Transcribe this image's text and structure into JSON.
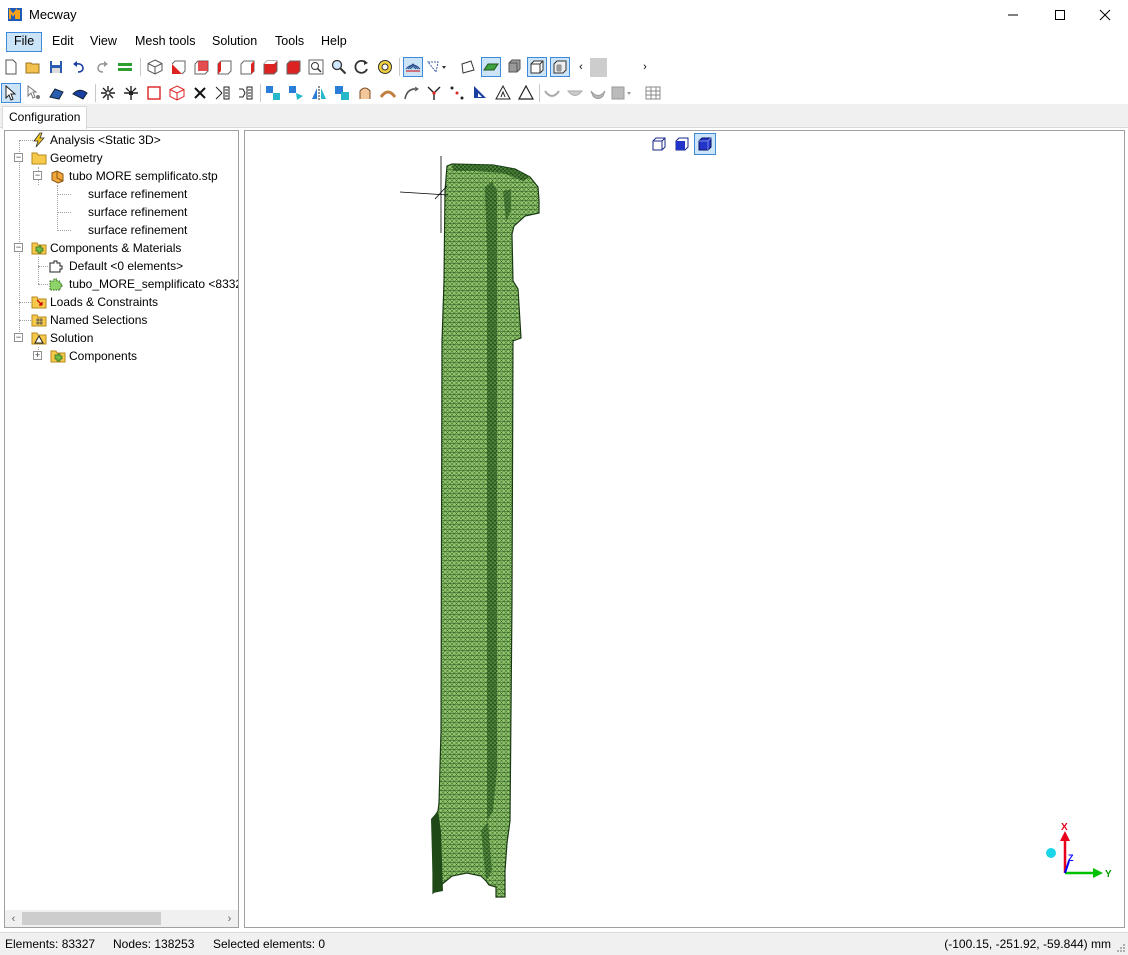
{
  "window": {
    "title": "Mecway"
  },
  "menu": {
    "items": [
      "File",
      "Edit",
      "View",
      "Mesh tools",
      "Solution",
      "Tools",
      "Help"
    ],
    "active": "File"
  },
  "tabs": {
    "configuration": "Configuration"
  },
  "tree": {
    "analysis": "Analysis <Static 3D>",
    "geometry": "Geometry",
    "geometry_file": "tubo MORE semplificato.stp",
    "refinement_1": "surface refinement",
    "refinement_2": "surface refinement",
    "refinement_3": "surface refinement",
    "components_materials": "Components & Materials",
    "default_component": "Default <0 elements>",
    "tube_component": "tubo_MORE_semplificato <8332",
    "loads_constraints": "Loads & Constraints",
    "named_selections": "Named Selections",
    "solution": "Solution",
    "solution_components": "Components"
  },
  "axes": {
    "x": "X",
    "y": "Y",
    "z": "Z"
  },
  "status": {
    "elements": "Elements: 83327",
    "nodes": "Nodes: 138253",
    "selected": "Selected elements: 0",
    "coordinates": "(-100.15, -251.92, -59.844) mm"
  },
  "colors": {
    "mesh_fill": "#8fc46a",
    "mesh_line": "#1f4a18",
    "selection_blue": "#cce4f7",
    "accent_border": "#3f8ad8",
    "axis_x": "#e8001c",
    "axis_y": "#00c000",
    "axis_z": "#0000ff"
  }
}
